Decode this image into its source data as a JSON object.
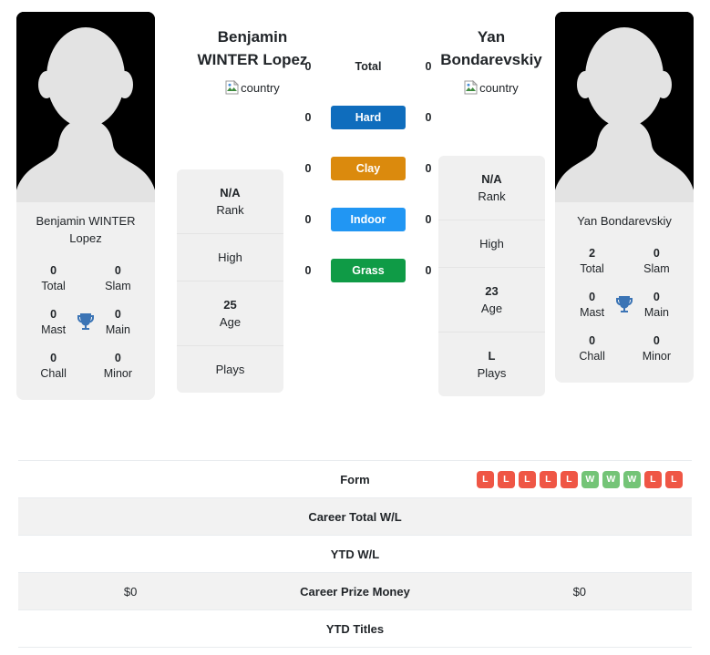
{
  "players": {
    "left": {
      "display_name": "Benjamin WINTER Lopez",
      "header_line1": "Benjamin",
      "header_line2": "WINTER Lopez",
      "country_alt": "country",
      "card_name": "Benjamin WINTER Lopez",
      "titles": {
        "total_value": "0",
        "total_label": "Total",
        "slam_value": "0",
        "slam_label": "Slam",
        "mast_value": "0",
        "mast_label": "Mast",
        "main_value": "0",
        "main_label": "Main",
        "chall_value": "0",
        "chall_label": "Chall",
        "minor_value": "0",
        "minor_label": "Minor"
      },
      "info": [
        {
          "value": "N/A",
          "label": "Rank"
        },
        {
          "value": "",
          "label": "High"
        },
        {
          "value": "25",
          "label": "Age"
        },
        {
          "value": "",
          "label": "Plays"
        }
      ]
    },
    "right": {
      "display_name": "Yan Bondarevskiy",
      "header_line1": "Yan",
      "header_line2": "Bondarevskiy",
      "country_alt": "country",
      "card_name": "Yan Bondarevskiy",
      "titles": {
        "total_value": "2",
        "total_label": "Total",
        "slam_value": "0",
        "slam_label": "Slam",
        "mast_value": "0",
        "mast_label": "Mast",
        "main_value": "0",
        "main_label": "Main",
        "chall_value": "0",
        "chall_label": "Chall",
        "minor_value": "0",
        "minor_label": "Minor"
      },
      "info": [
        {
          "value": "N/A",
          "label": "Rank"
        },
        {
          "value": "",
          "label": "High"
        },
        {
          "value": "23",
          "label": "Age"
        },
        {
          "value": "L",
          "label": "Plays"
        }
      ]
    }
  },
  "surfaces": [
    {
      "label": "Total",
      "left": "0",
      "right": "0",
      "color": "",
      "style": "plain"
    },
    {
      "label": "Hard",
      "left": "0",
      "right": "0",
      "color": "#0f6dbd",
      "style": "pill"
    },
    {
      "label": "Clay",
      "left": "0",
      "right": "0",
      "color": "#db8a0d",
      "style": "pill"
    },
    {
      "label": "Indoor",
      "left": "0",
      "right": "0",
      "color": "#2196f3",
      "style": "pill"
    },
    {
      "label": "Grass",
      "left": "0",
      "right": "0",
      "color": "#0f9b46",
      "style": "pill"
    }
  ],
  "facts": [
    {
      "label": "Form",
      "left_value": "",
      "right_value": "",
      "striped": false,
      "right_form": [
        "L",
        "L",
        "L",
        "L",
        "L",
        "W",
        "W",
        "W",
        "L",
        "L"
      ],
      "left_form": []
    },
    {
      "label": "Career Total W/L",
      "left_value": "",
      "right_value": "",
      "striped": true,
      "right_form": [],
      "left_form": []
    },
    {
      "label": "YTD W/L",
      "left_value": "",
      "right_value": "",
      "striped": false,
      "right_form": [],
      "left_form": []
    },
    {
      "label": "Career Prize Money",
      "left_value": "$0",
      "right_value": "$0",
      "striped": true,
      "right_form": [],
      "left_form": []
    },
    {
      "label": "YTD Titles",
      "left_value": "",
      "right_value": "",
      "striped": false,
      "right_form": [],
      "left_form": []
    }
  ],
  "colors": {
    "win_badge": "#74c477",
    "loss_badge": "#ef5645",
    "trophy": "#3b74b5",
    "card_bg": "#f0f0f0",
    "row_stripe": "#f2f2f2"
  },
  "icons": {
    "trophy": "trophy-icon",
    "avatar": "avatar-silhouette-icon",
    "broken_image": "broken-image-icon"
  }
}
